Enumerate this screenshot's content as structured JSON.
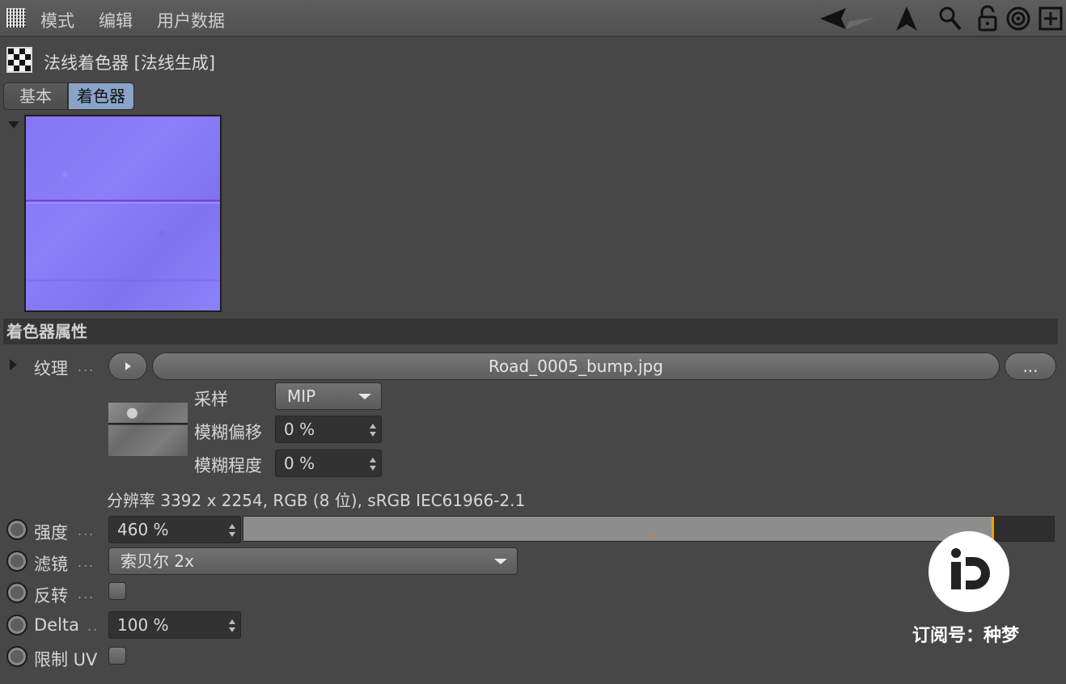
{
  "menu": {
    "items": [
      "模式",
      "编辑",
      "用户数据"
    ]
  },
  "header": {
    "title": "法线着色器 [法线生成]"
  },
  "tabs": [
    {
      "label": "基本",
      "active": false
    },
    {
      "label": "着色器",
      "active": true
    }
  ],
  "section": {
    "title": "着色器属性"
  },
  "texture": {
    "label": "纹理",
    "file": "Road_0005_bump.jpg",
    "browse_label": "...",
    "sampling_label": "采样",
    "sampling_value": "MIP",
    "blur_offset_label": "模糊偏移",
    "blur_offset_value": "0 %",
    "blur_amount_label": "模糊程度",
    "blur_amount_value": "0 %",
    "resolution": "分辨率 3392 x 2254, RGB (8 位), sRGB IEC61966-2.1"
  },
  "strength": {
    "label": "强度",
    "value": "460 %",
    "slider_fraction": 0.923
  },
  "filter": {
    "label": "滤镜",
    "value": "索贝尔 2x"
  },
  "invert": {
    "label": "反转",
    "checked": false
  },
  "delta": {
    "label": "Delta",
    "value": "100 %"
  },
  "clamp_uv": {
    "label": "限制 UV",
    "checked": false
  },
  "watermark": {
    "text": "订阅号：种梦"
  },
  "colors": {
    "background": "#474747",
    "active_tab": "#8aa3c9",
    "slider_handle": "#f0a000",
    "preview_normal_map": "#8477f3"
  }
}
